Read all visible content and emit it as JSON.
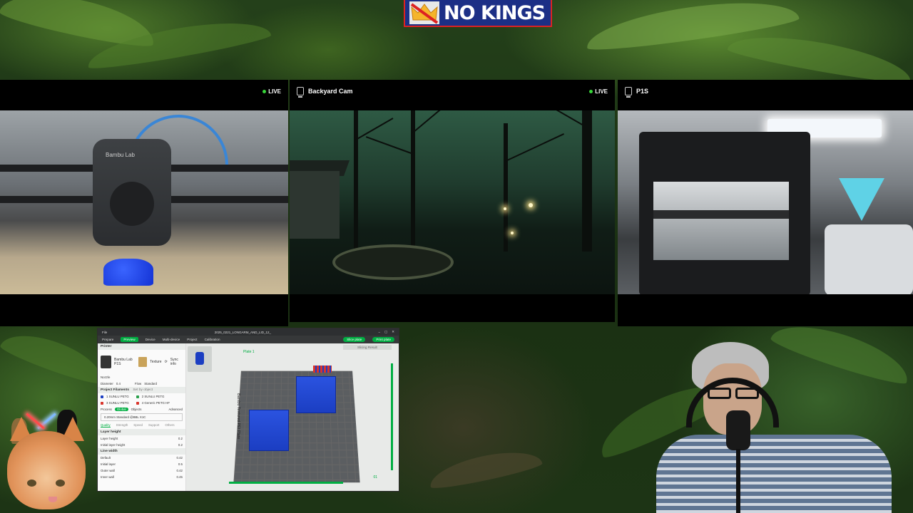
{
  "banner": {
    "text": "NO KINGS"
  },
  "cams": [
    {
      "name": "",
      "live": "LIVE",
      "toolhead_label": "Bambu Lab"
    },
    {
      "name": "Backyard Cam",
      "live": "LIVE"
    },
    {
      "name": "P1S",
      "live": ""
    }
  ],
  "slicer": {
    "title": "2025_0221_LONGARM_AND_LID_12_",
    "menu": [
      "File"
    ],
    "tabs": [
      "Prepare",
      "Preview",
      "Device",
      "Multi-device",
      "Project",
      "Calibration"
    ],
    "active_tab": "Preview",
    "slice_button": "Slice plate",
    "print_button": "Print plate",
    "canvas_title": "Slicing Result",
    "plate_label": "Plate 1",
    "bed_brand": "Bambu Textured PEI Plate",
    "left": {
      "printer_section": "Printer",
      "printer_name": "Bambu Lab P1S",
      "plate_label": "Texture",
      "sync_label": "Sync info",
      "nozzle_label": "Nozzle",
      "diameter_label": "Diameter",
      "diameter_value": "0.4",
      "flow_label": "Flow",
      "flow_value": "Standard",
      "filament_section": "Project Filaments",
      "filament_tag": "Set by object",
      "filaments": [
        "1 SUNLU PETG",
        "2 SUNLU PETG",
        "3 SUNLU PETG",
        "4 Generic PETG HF"
      ],
      "process_label": "Process",
      "global_label": "Global",
      "objects_label": "Objects",
      "advanced_label": "Advanced",
      "preset": "0.20mm Standard @BBL X1C",
      "qtabs": [
        "Quality",
        "Strength",
        "Speed",
        "Support",
        "Others"
      ],
      "layer_section": "Layer height",
      "layer_rows": [
        {
          "label": "Layer height",
          "value": "0.2"
        },
        {
          "label": "Initial layer height",
          "value": "0.2"
        }
      ],
      "line_section": "Line width",
      "line_rows": [
        {
          "label": "Default",
          "value": "0.42"
        },
        {
          "label": "Initial layer",
          "value": "0.5"
        },
        {
          "label": "Outer wall",
          "value": "0.42"
        },
        {
          "label": "Inner wall",
          "value": "0.45"
        }
      ]
    },
    "slider_top": "",
    "slider_bottom": "01"
  },
  "colors": {
    "accent_green": "#00ae42",
    "banner_blue": "#1c2f86",
    "print_blue": "#1b3ec2",
    "live_dot": "#38d63a"
  }
}
